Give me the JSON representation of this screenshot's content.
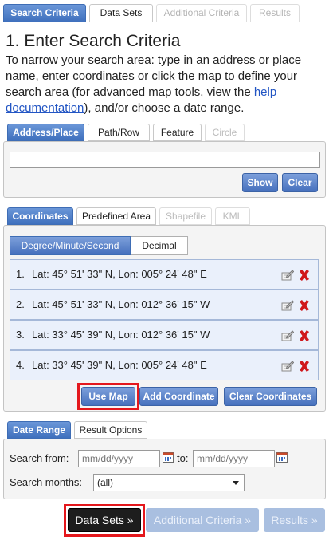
{
  "main_tabs": [
    "Search Criteria",
    "Data Sets",
    "Additional Criteria",
    "Results"
  ],
  "heading": "1. Enter Search Criteria",
  "intro": {
    "before_link": "To narrow your search area: type in an address or place name, enter coordinates or click the map to define your search area (for advanced map tools, view the ",
    "link": "help documentation",
    "after_link": "), and/or choose a date range."
  },
  "address_tabs": [
    "Address/Place",
    "Path/Row",
    "Feature",
    "Circle"
  ],
  "address_input": {
    "value": "",
    "placeholder": ""
  },
  "address_buttons": {
    "show": "Show",
    "clear": "Clear"
  },
  "coord_tabs": [
    "Coordinates",
    "Predefined Area",
    "Shapefile",
    "KML"
  ],
  "format_tabs": [
    "Degree/Minute/Second",
    "Decimal"
  ],
  "coordinates": [
    {
      "num": "1.",
      "text": "Lat: 45° 51' 33\" N, Lon: 005° 24' 48\" E"
    },
    {
      "num": "2.",
      "text": "Lat: 45° 51' 33\" N, Lon: 012° 36' 15\" W"
    },
    {
      "num": "3.",
      "text": "Lat: 33° 45' 39\" N, Lon: 012° 36' 15\" W"
    },
    {
      "num": "4.",
      "text": "Lat: 33° 45' 39\" N, Lon: 005° 24' 48\" E"
    }
  ],
  "coord_buttons": {
    "use_map": "Use Map",
    "add": "Add Coordinate",
    "clear": "Clear Coordinates"
  },
  "date_tabs": [
    "Date Range",
    "Result Options"
  ],
  "date": {
    "from_label": "Search from:",
    "from_placeholder": "mm/dd/yyyy",
    "to_label": "to:",
    "to_placeholder": "mm/dd/yyyy",
    "months_label": "Search months:",
    "months_value": "(all)"
  },
  "footer": {
    "data_sets": "Data Sets »",
    "additional": "Additional Criteria »",
    "results": "Results »"
  },
  "colors": {
    "accent": "#4f7fc6",
    "highlight": "#e4171c",
    "delete": "#d0171b"
  }
}
